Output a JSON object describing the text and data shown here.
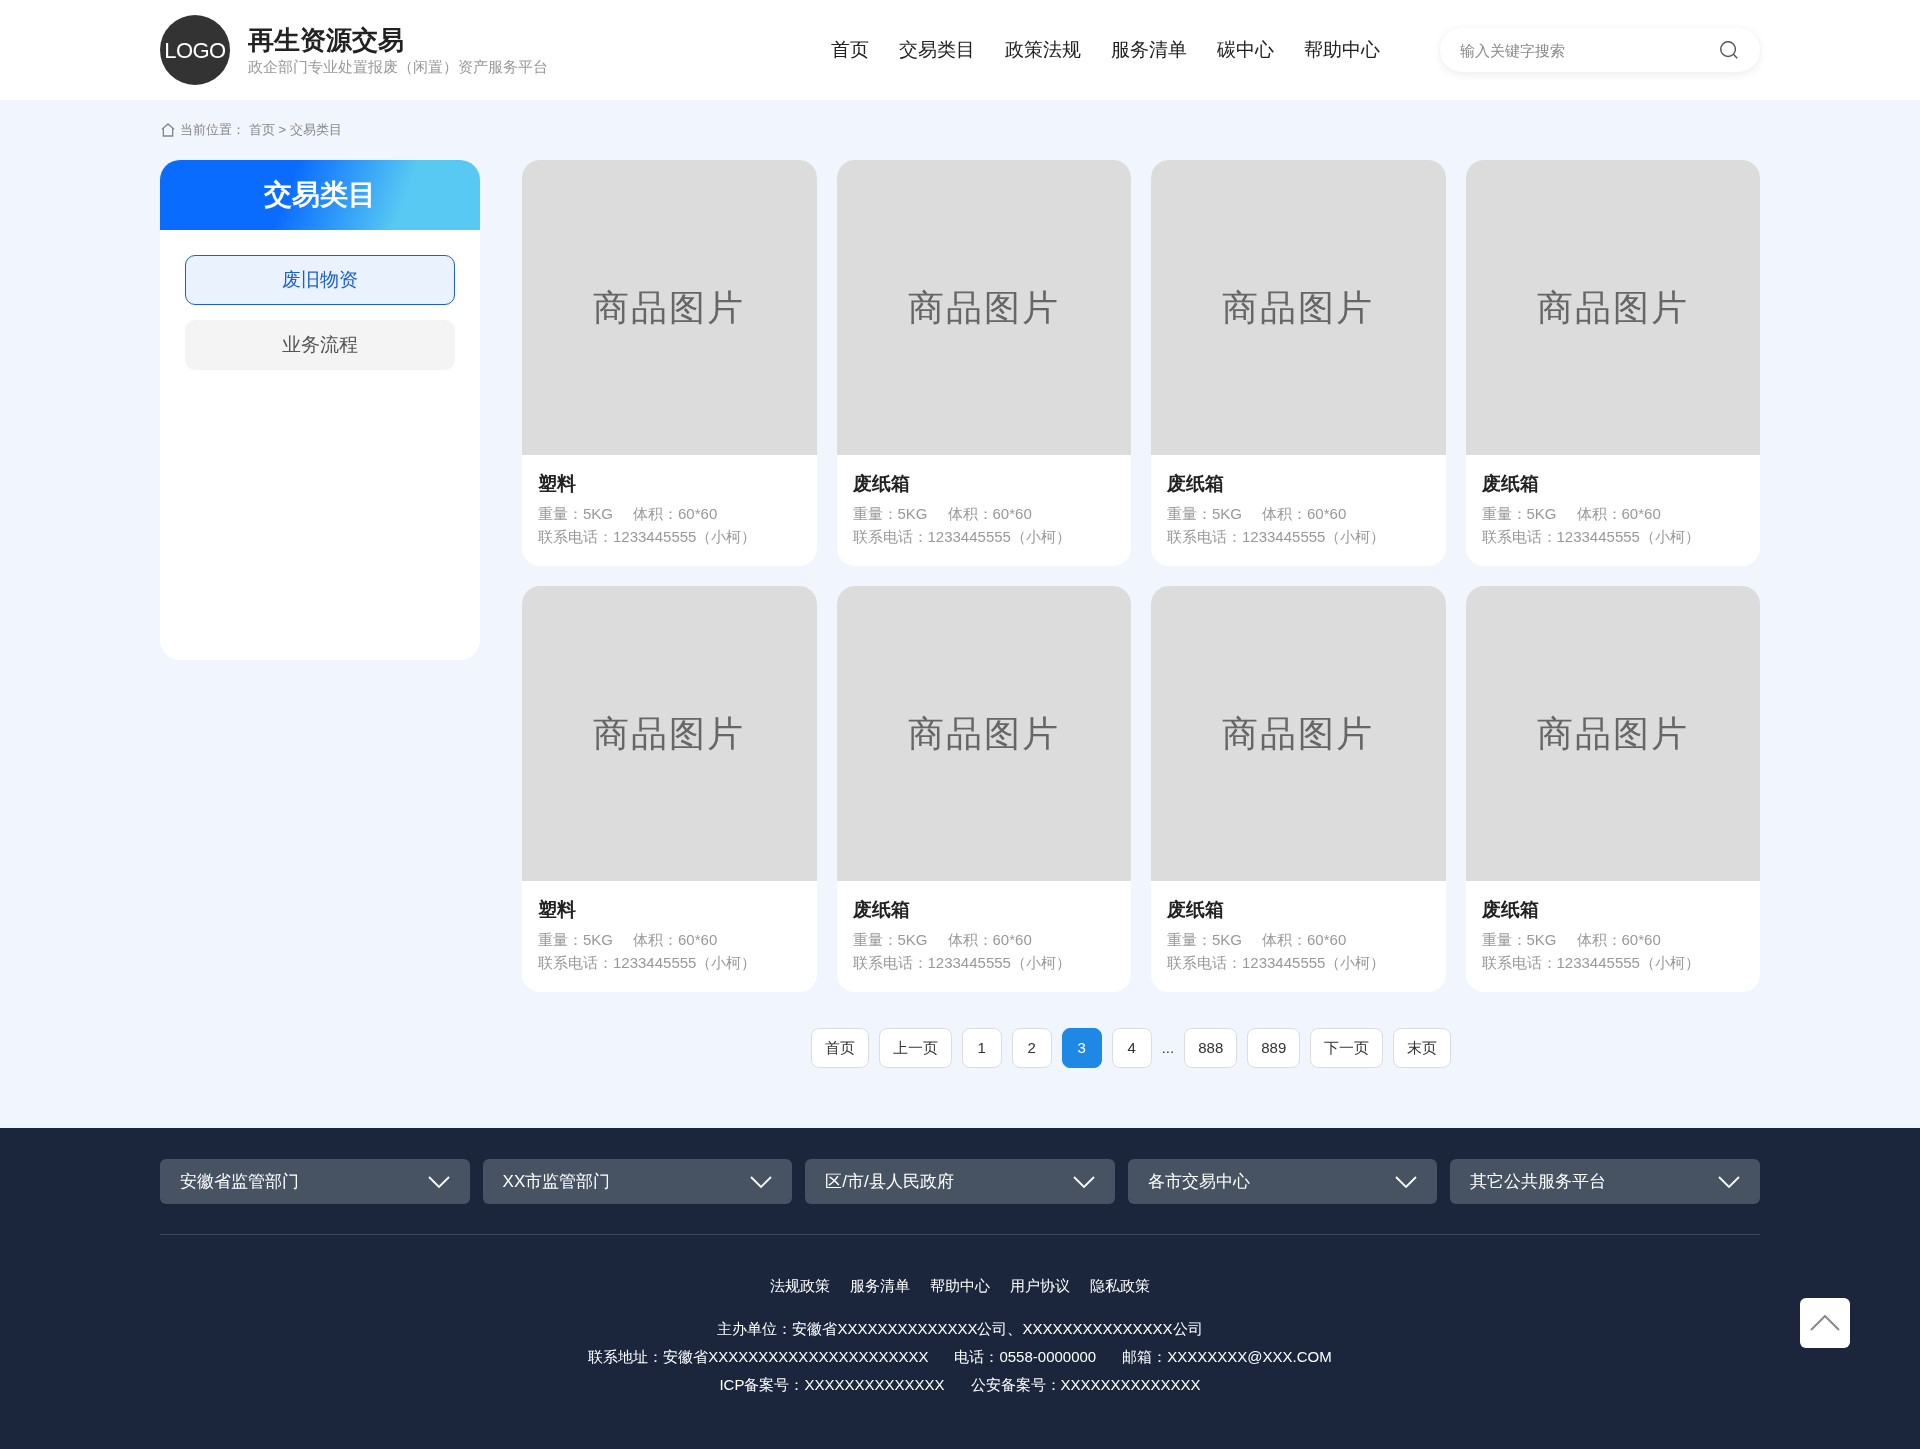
{
  "header": {
    "logo": "LOGO",
    "title": "再生资源交易",
    "subtitle": "政企部门专业处置报废（闲置）资产服务平台",
    "nav": [
      {
        "label": "首页",
        "selected": false
      },
      {
        "label": "交易类目",
        "selected": false
      },
      {
        "label": "政策法规",
        "selected": false
      },
      {
        "label": "服务清单",
        "selected": false
      },
      {
        "label": "碳中心",
        "selected": false
      },
      {
        "label": "帮助中心",
        "selected": false
      }
    ],
    "search": {
      "placeholder": "输入关键字搜索"
    }
  },
  "breadcrumb": {
    "label": "当前位置：",
    "path": "首页 > 交易类目"
  },
  "sidebar": {
    "title": "交易类目",
    "items": [
      {
        "label": "废旧物资",
        "selected": true
      },
      {
        "label": "业务流程",
        "selected": false
      }
    ]
  },
  "products": [
    {
      "image_label": "商品图片",
      "name": "塑料",
      "weight": "重量：5KG",
      "volume": "体积：60*60",
      "contact": "联系电话：1233445555（小柯）"
    },
    {
      "image_label": "商品图片",
      "name": "废纸箱",
      "weight": "重量：5KG",
      "volume": "体积：60*60",
      "contact": "联系电话：1233445555（小柯）"
    },
    {
      "image_label": "商品图片",
      "name": "废纸箱",
      "weight": "重量：5KG",
      "volume": "体积：60*60",
      "contact": "联系电话：1233445555（小柯）"
    },
    {
      "image_label": "商品图片",
      "name": "废纸箱",
      "weight": "重量：5KG",
      "volume": "体积：60*60",
      "contact": "联系电话：1233445555（小柯）"
    },
    {
      "image_label": "商品图片",
      "name": "塑料",
      "weight": "重量：5KG",
      "volume": "体积：60*60",
      "contact": "联系电话：1233445555（小柯）"
    },
    {
      "image_label": "商品图片",
      "name": "废纸箱",
      "weight": "重量：5KG",
      "volume": "体积：60*60",
      "contact": "联系电话：1233445555（小柯）"
    },
    {
      "image_label": "商品图片",
      "name": "废纸箱",
      "weight": "重量：5KG",
      "volume": "体积：60*60",
      "contact": "联系电话：1233445555（小柯）"
    },
    {
      "image_label": "商品图片",
      "name": "废纸箱",
      "weight": "重量：5KG",
      "volume": "体积：60*60",
      "contact": "联系电话：1233445555（小柯）"
    }
  ],
  "pagination": [
    {
      "kind": "button",
      "label": "首页",
      "selected": false
    },
    {
      "kind": "button",
      "label": "上一页",
      "selected": false
    },
    {
      "kind": "button",
      "label": "1",
      "selected": false
    },
    {
      "kind": "button",
      "label": "2",
      "selected": false
    },
    {
      "kind": "button",
      "label": "3",
      "selected": true
    },
    {
      "kind": "button",
      "label": "4",
      "selected": false
    },
    {
      "kind": "ellipsis",
      "label": "..."
    },
    {
      "kind": "button",
      "label": "888",
      "selected": false
    },
    {
      "kind": "button",
      "label": "889",
      "selected": false
    },
    {
      "kind": "button",
      "label": "下一页",
      "selected": false
    },
    {
      "kind": "button",
      "label": "末页",
      "selected": false
    }
  ],
  "footer": {
    "dropdowns": [
      "安徽省监管部门",
      "XX市监管部门",
      "区/市/县人民政府",
      "各市交易中心",
      "其它公共服务平台"
    ],
    "links": [
      "法规政策",
      "服务清单",
      "帮助中心",
      "用户协议",
      "隐私政策"
    ],
    "info_lines": [
      [
        "主办单位：安徽省XXXXXXXXXXXXXX公司、XXXXXXXXXXXXXXX公司"
      ],
      [
        "联系地址：安徽省XXXXXXXXXXXXXXXXXXXXXX",
        "电话：0558-0000000",
        "邮箱：XXXXXXXX@XXX.COM"
      ],
      [
        "ICP备案号：XXXXXXXXXXXXXX",
        "公安备案号：XXXXXXXXXXXXXX"
      ]
    ]
  }
}
